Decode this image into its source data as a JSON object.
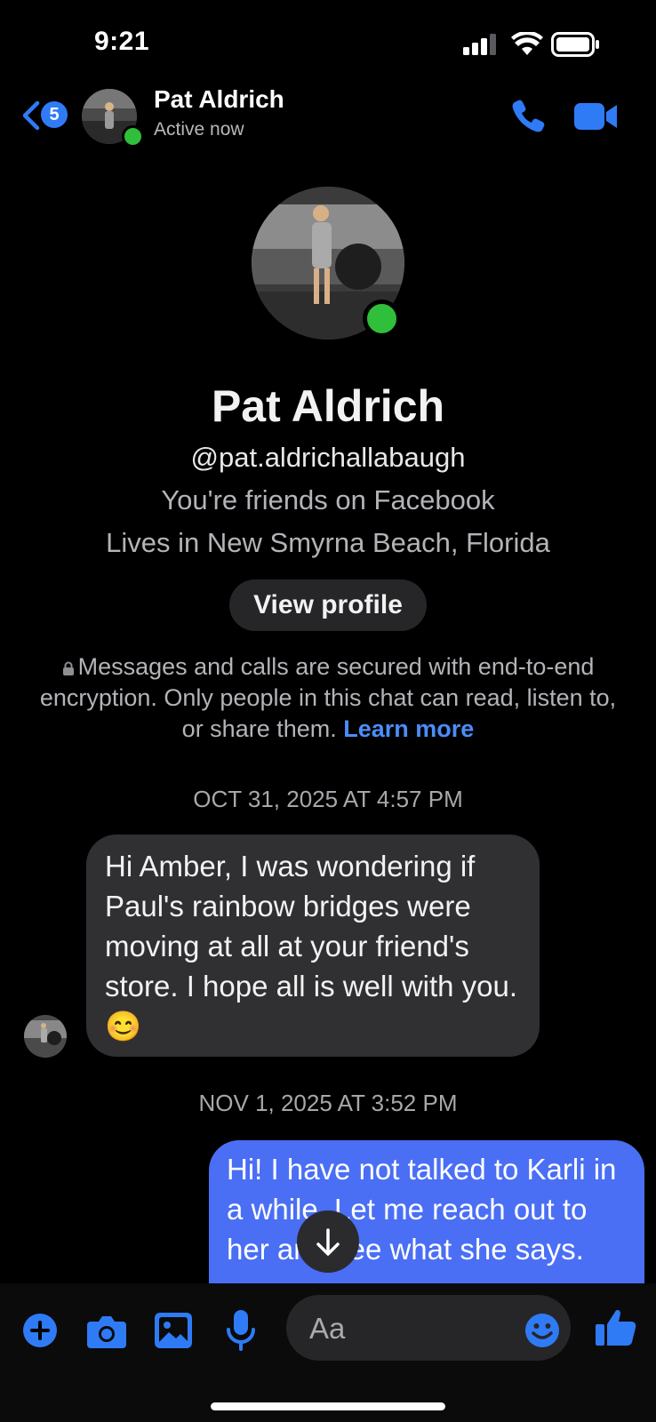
{
  "status_bar": {
    "time": "9:21"
  },
  "header": {
    "back_badge": "5",
    "contact_name": "Pat Aldrich",
    "contact_status": "Active now",
    "call_icon": "phone-icon",
    "video_icon": "video-camera-icon"
  },
  "profile": {
    "name": "Pat Aldrich",
    "handle": "@pat.aldrichallabaugh",
    "friends_text": "You're friends on Facebook",
    "lives_text": "Lives in New Smyrna Beach, Florida",
    "view_profile_label": "View profile"
  },
  "encryption": {
    "text": "Messages and calls are secured with end-to-end encryption. Only people in this chat can read, listen to, or share them.",
    "learn_more": "Learn more"
  },
  "messages": [
    {
      "timestamp": "OCT 31, 2025 AT 4:57 PM",
      "direction": "incoming",
      "text": "Hi Amber, I was wondering if Paul's rainbow bridges were moving at all at your friend's store. I hope all is well with you. 😊"
    },
    {
      "timestamp": "NOV 1, 2025 AT 3:52 PM",
      "direction": "outgoing",
      "text": "Hi! I have not talked to Karli in a while. Let me reach out to her and see what she says."
    }
  ],
  "composer": {
    "placeholder": "Aa",
    "icons": [
      "plus-icon",
      "camera-icon",
      "photo-icon",
      "microphone-icon",
      "emoji-icon",
      "thumbs-up-icon"
    ]
  },
  "colors": {
    "accent": "#2f7bf6",
    "outgoing_bubble": "#4a6ff5",
    "incoming_bubble": "#303032",
    "online": "#2fbf3a"
  }
}
